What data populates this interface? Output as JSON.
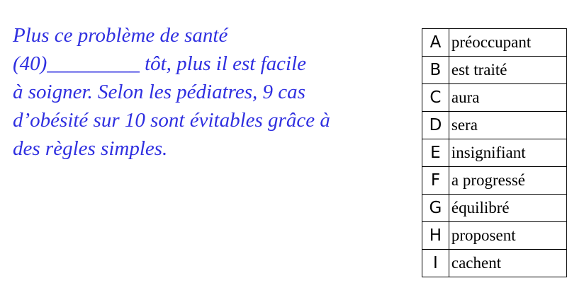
{
  "passage": {
    "lines": [
      "Plus ce problème de santé",
      "(40)_________ tôt, plus il est facile",
      "à soigner. Selon les pédiatres, 9 cas",
      "d’obésité sur 10 sont évitables grâce à",
      "des règles simples."
    ]
  },
  "options": [
    {
      "letter": "A",
      "word": "préoccupant"
    },
    {
      "letter": "B",
      "word": "est traité"
    },
    {
      "letter": "C",
      "word": "aura"
    },
    {
      "letter": "D",
      "word": "sera"
    },
    {
      "letter": "E",
      "word": "insignifiant"
    },
    {
      "letter": "F",
      "word": "a progressé"
    },
    {
      "letter": "G",
      "word": "équilibré"
    },
    {
      "letter": "H",
      "word": "proposent"
    },
    {
      "letter": "I",
      "word": "cachent"
    }
  ],
  "colors": {
    "passage_text": "#2f2fe0",
    "table_text": "#000000"
  }
}
